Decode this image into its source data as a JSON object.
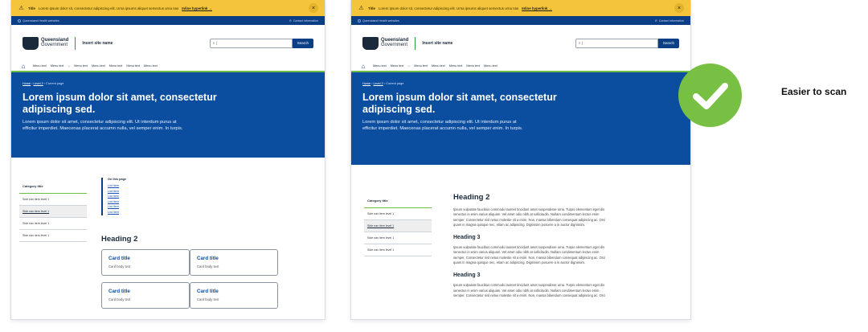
{
  "alert": {
    "title": "Title",
    "text": "Lorem ipsum dolor sit, consectetur adipiscing elit. Urna ipsums aliquet semectus urna nas",
    "link": "Inline hyperlink →",
    "close": "×"
  },
  "topbar": {
    "left": "Queensland Health websites",
    "right": "Contact information"
  },
  "brand": {
    "line1": "Queensland",
    "line2": "Government",
    "site": "Insert site name"
  },
  "search": {
    "placeholder": "|",
    "button": "Search"
  },
  "nav": {
    "items": [
      "Menu text",
      "Menu text",
      "Menu text",
      "Menu text",
      "Menu text",
      "Menu text",
      "Menu text"
    ],
    "chevron": "⌵"
  },
  "hero": {
    "crumbs": [
      "Home",
      "Level 2",
      "Current page"
    ],
    "title_l1": "Lorem ipsum dolor sit amet, consectetur",
    "title_l2": "adipiscing sed.",
    "body_l1": "Lorem ipsum dolor sit amet, consectetur adipiscing elit. Ut interdum purus at",
    "body_l2": "efficitur imperdiet. Maecenas placerat accumn nulla, vel semper enim. In turpis."
  },
  "side": {
    "title": "Category title",
    "items": [
      "Side nav item level 1",
      "Side nav item level 1",
      "Side nav item level 1",
      "Side nav item level 1"
    ]
  },
  "otp": {
    "title": "On this page",
    "links": [
      "List item",
      "List item",
      "List item",
      "List item",
      "List item",
      "List item"
    ]
  },
  "left_content": {
    "heading": "Heading 2",
    "cards": [
      {
        "title": "Card title",
        "body": "Card body text"
      },
      {
        "title": "Card title",
        "body": "Card body text"
      },
      {
        "title": "Card title",
        "body": "Card body text"
      },
      {
        "title": "Card title",
        "body": "Card body text"
      }
    ]
  },
  "right_content": {
    "h2": "Heading 2",
    "h3a": "Heading 3",
    "h3b": "Heading 3",
    "para_l1": "Ipsum vulputate faucibus commodo laoreet tincidunt amet suspendisse urna. Turpis elementum eget dis",
    "para_l2": "senectus in enim varius aliquam. Vel amet odio nibh at sollicitudin. Nullam condimentum lectus enim",
    "para_l3": "semper. Consectetur nisl netus molestie sit a enim. Non, massa bibendum consequat adipiscing ac. Orci",
    "para_l4": "quam in magna quisque nec, etiam ac adipiscing. Dignissim posuere a in auctor dignissim."
  },
  "annotation": {
    "label": "Easier to scan"
  },
  "colors": {
    "alert": "#f4c53a",
    "topbar": "#0b3e84",
    "hero": "#0b4ea0",
    "accent_green": "#6cbe45",
    "check": "#78c043"
  }
}
